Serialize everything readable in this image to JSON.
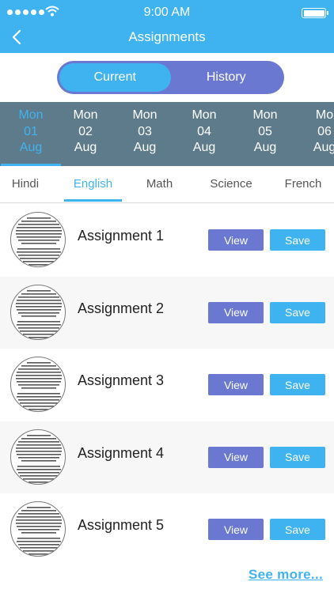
{
  "status_bar": {
    "time": "9:00 AM"
  },
  "header": {
    "title": "Assignments",
    "back_icon": "chevron-left-icon"
  },
  "segment": {
    "current_label": "Current",
    "history_label": "History",
    "selected": "Current"
  },
  "dates": [
    {
      "day": "Mon",
      "date": "01",
      "month": "Aug",
      "selected": true
    },
    {
      "day": "Mon",
      "date": "02",
      "month": "Aug",
      "selected": false
    },
    {
      "day": "Mon",
      "date": "03",
      "month": "Aug",
      "selected": false
    },
    {
      "day": "Mon",
      "date": "04",
      "month": "Aug",
      "selected": false
    },
    {
      "day": "Mon",
      "date": "05",
      "month": "Aug",
      "selected": false
    },
    {
      "day": "Mo",
      "date": "06",
      "month": "Aug",
      "selected": false
    }
  ],
  "subjects": [
    {
      "label": "Hindi",
      "selected": false
    },
    {
      "label": "English",
      "selected": true
    },
    {
      "label": "Math",
      "selected": false
    },
    {
      "label": "Science",
      "selected": false
    },
    {
      "label": "French",
      "selected": false
    }
  ],
  "assignments": [
    {
      "title": "Assignment 1",
      "view_label": "View",
      "save_label": "Save"
    },
    {
      "title": "Assignment 2",
      "view_label": "View",
      "save_label": "Save"
    },
    {
      "title": "Assignment 3",
      "view_label": "View",
      "save_label": "Save"
    },
    {
      "title": "Assignment 4",
      "view_label": "View",
      "save_label": "Save"
    },
    {
      "title": "Assignment 5",
      "view_label": "View",
      "save_label": "Save"
    }
  ],
  "see_more_label": "See more...",
  "colors": {
    "primary": "#3fb3f0",
    "secondary": "#6a78d1",
    "date_strip": "#5e7b8c"
  }
}
